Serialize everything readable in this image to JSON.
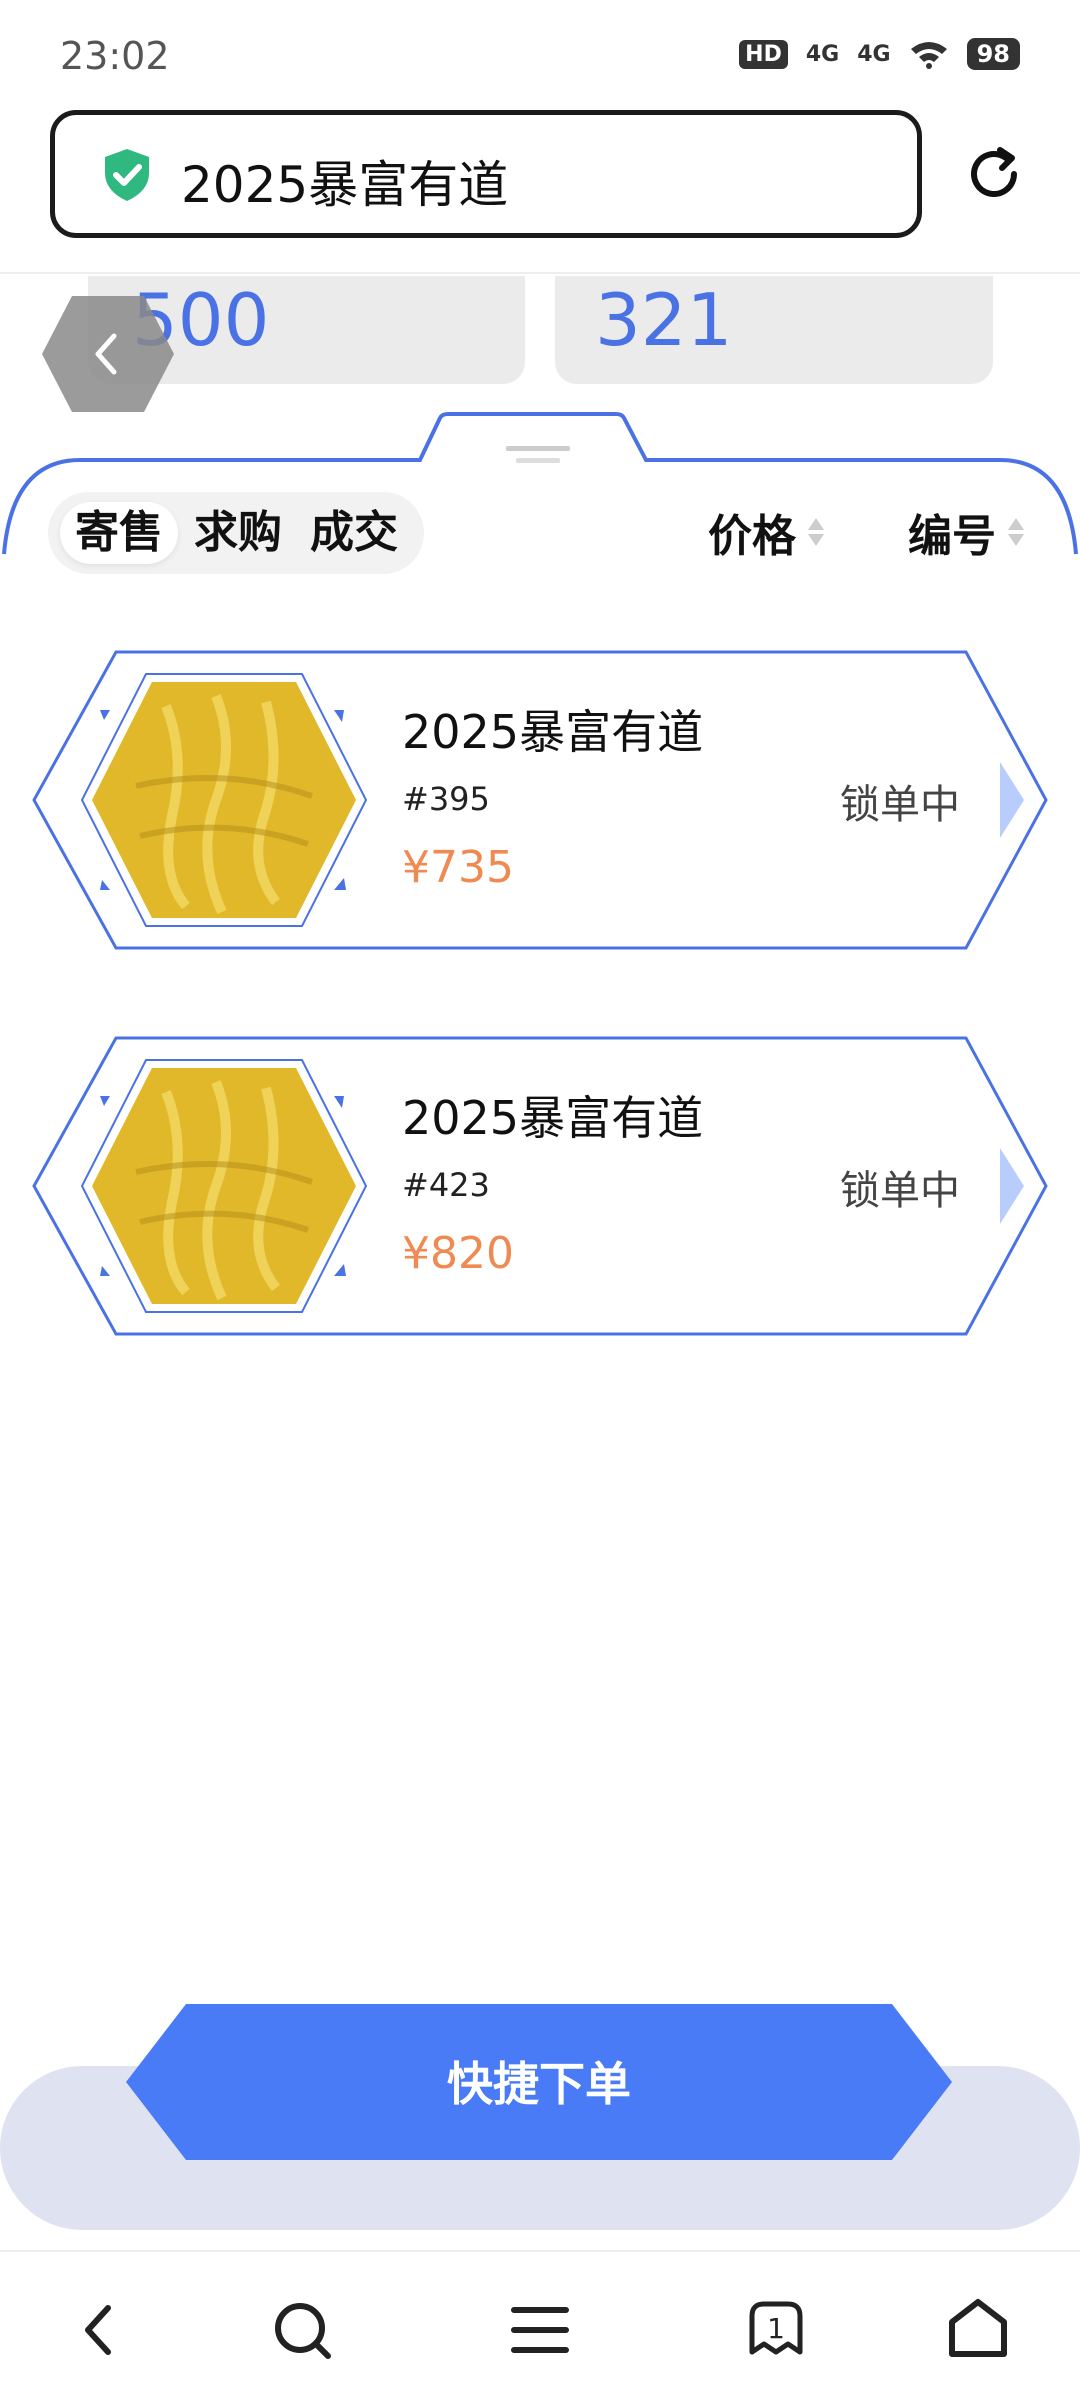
{
  "status_bar": {
    "time": "23:02",
    "hd": "HD",
    "signal1": "4G",
    "signal2": "4G",
    "battery": "98"
  },
  "address_bar": {
    "title": "2025暴富有道"
  },
  "stats": [
    {
      "value": "500"
    },
    {
      "value": "321"
    }
  ],
  "tabs": [
    {
      "label": "寄售"
    },
    {
      "label": "求购"
    },
    {
      "label": "成交"
    }
  ],
  "sort": {
    "price_label": "价格",
    "number_label": "编号"
  },
  "listings": [
    {
      "title": "2025暴富有道",
      "number": "#395",
      "price": "¥735",
      "status": "锁单中"
    },
    {
      "title": "2025暴富有道",
      "number": "#423",
      "price": "¥820",
      "status": "锁单中"
    }
  ],
  "quick_order": {
    "label": "快捷下单"
  },
  "nav": {
    "tab_count": "1"
  },
  "colors": {
    "accent": "#4a7bf7",
    "outline": "#4a72e4",
    "price": "#ee8a52",
    "gold": "#e0b82a"
  },
  "icons": [
    "shield-check-icon",
    "refresh-icon",
    "back-icon",
    "sort-icon",
    "chevron-right-icon",
    "search-icon",
    "menu-icon",
    "tabs-icon",
    "home-icon"
  ]
}
